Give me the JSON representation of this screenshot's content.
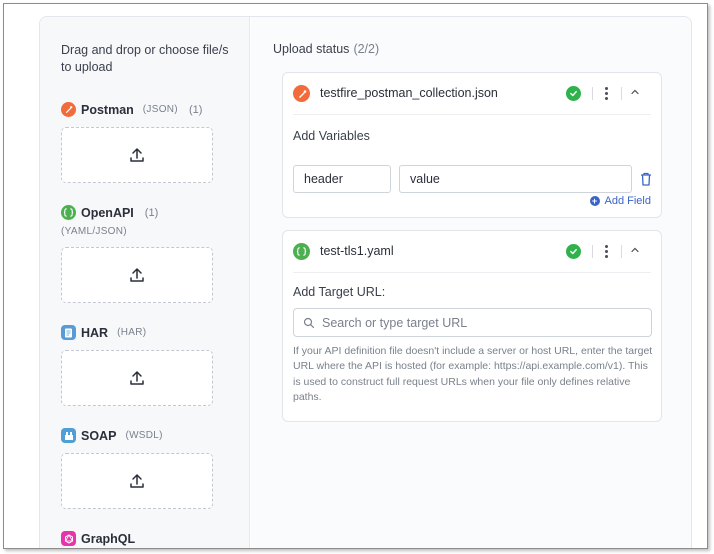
{
  "left": {
    "title": "Drag and drop or choose file/s to upload",
    "types": [
      {
        "name": "Postman",
        "format": "(JSON)",
        "count": "(1)",
        "color": "#f26b3a",
        "icon": "postman-icon"
      },
      {
        "name": "OpenAPI",
        "format": "",
        "count": "(1)",
        "subformat": "(YAML/JSON)",
        "color": "#4caf50",
        "icon": "openapi-icon"
      },
      {
        "name": "HAR",
        "format": "(HAR)",
        "count": "",
        "color": "#5b9bd5",
        "icon": "har-icon"
      },
      {
        "name": "SOAP",
        "format": "(WSDL)",
        "count": "",
        "color": "#4f9fd6",
        "icon": "soap-icon"
      },
      {
        "name": "GraphQL",
        "format": "",
        "count": "",
        "color": "#e535ab",
        "icon": "graphql-icon"
      }
    ],
    "upload_icon": "upload-icon"
  },
  "status": {
    "title": "Upload status",
    "count": "(2/2)"
  },
  "card1": {
    "file_name": "testfire_postman_collection.json",
    "section_label": "Add Variables",
    "key_value": "header",
    "value_value": "value",
    "add_field_label": "Add Field"
  },
  "card2": {
    "file_name": "test-tls1.yaml",
    "section_label": "Add Target URL:",
    "search_placeholder": "Search or type target URL",
    "help_text": "If your API definition file doesn't include a server or host URL, enter the target URL where the API is hosted (for example: https://api.example.com/v1). This is used to construct full request URLs when your file only defines relative paths."
  },
  "colors": {
    "accent": "#3b64c9",
    "success": "#2fb14c"
  }
}
